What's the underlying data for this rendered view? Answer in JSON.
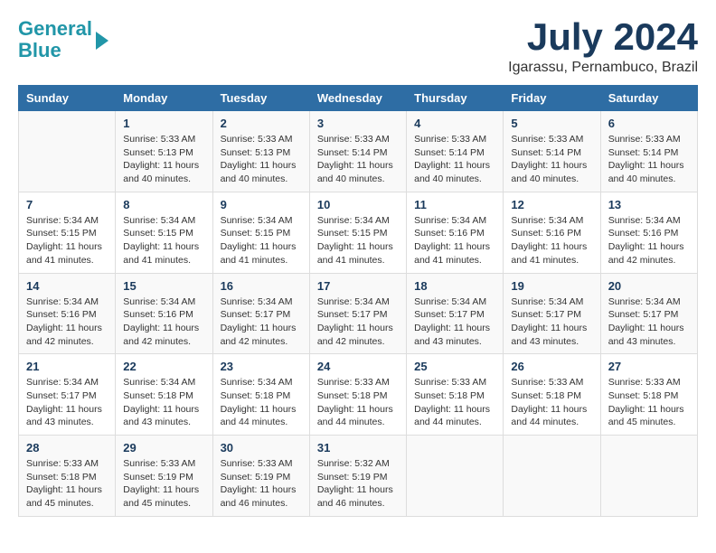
{
  "header": {
    "logo_line1": "General",
    "logo_line2": "Blue",
    "month_title": "July 2024",
    "location": "Igarassu, Pernambuco, Brazil"
  },
  "columns": [
    "Sunday",
    "Monday",
    "Tuesday",
    "Wednesday",
    "Thursday",
    "Friday",
    "Saturday"
  ],
  "weeks": [
    [
      {
        "day": "",
        "info": ""
      },
      {
        "day": "1",
        "info": "Sunrise: 5:33 AM\nSunset: 5:13 PM\nDaylight: 11 hours\nand 40 minutes."
      },
      {
        "day": "2",
        "info": "Sunrise: 5:33 AM\nSunset: 5:13 PM\nDaylight: 11 hours\nand 40 minutes."
      },
      {
        "day": "3",
        "info": "Sunrise: 5:33 AM\nSunset: 5:14 PM\nDaylight: 11 hours\nand 40 minutes."
      },
      {
        "day": "4",
        "info": "Sunrise: 5:33 AM\nSunset: 5:14 PM\nDaylight: 11 hours\nand 40 minutes."
      },
      {
        "day": "5",
        "info": "Sunrise: 5:33 AM\nSunset: 5:14 PM\nDaylight: 11 hours\nand 40 minutes."
      },
      {
        "day": "6",
        "info": "Sunrise: 5:33 AM\nSunset: 5:14 PM\nDaylight: 11 hours\nand 40 minutes."
      }
    ],
    [
      {
        "day": "7",
        "info": "Sunrise: 5:34 AM\nSunset: 5:15 PM\nDaylight: 11 hours\nand 41 minutes."
      },
      {
        "day": "8",
        "info": "Sunrise: 5:34 AM\nSunset: 5:15 PM\nDaylight: 11 hours\nand 41 minutes."
      },
      {
        "day": "9",
        "info": "Sunrise: 5:34 AM\nSunset: 5:15 PM\nDaylight: 11 hours\nand 41 minutes."
      },
      {
        "day": "10",
        "info": "Sunrise: 5:34 AM\nSunset: 5:15 PM\nDaylight: 11 hours\nand 41 minutes."
      },
      {
        "day": "11",
        "info": "Sunrise: 5:34 AM\nSunset: 5:16 PM\nDaylight: 11 hours\nand 41 minutes."
      },
      {
        "day": "12",
        "info": "Sunrise: 5:34 AM\nSunset: 5:16 PM\nDaylight: 11 hours\nand 41 minutes."
      },
      {
        "day": "13",
        "info": "Sunrise: 5:34 AM\nSunset: 5:16 PM\nDaylight: 11 hours\nand 42 minutes."
      }
    ],
    [
      {
        "day": "14",
        "info": "Sunrise: 5:34 AM\nSunset: 5:16 PM\nDaylight: 11 hours\nand 42 minutes."
      },
      {
        "day": "15",
        "info": "Sunrise: 5:34 AM\nSunset: 5:16 PM\nDaylight: 11 hours\nand 42 minutes."
      },
      {
        "day": "16",
        "info": "Sunrise: 5:34 AM\nSunset: 5:17 PM\nDaylight: 11 hours\nand 42 minutes."
      },
      {
        "day": "17",
        "info": "Sunrise: 5:34 AM\nSunset: 5:17 PM\nDaylight: 11 hours\nand 42 minutes."
      },
      {
        "day": "18",
        "info": "Sunrise: 5:34 AM\nSunset: 5:17 PM\nDaylight: 11 hours\nand 43 minutes."
      },
      {
        "day": "19",
        "info": "Sunrise: 5:34 AM\nSunset: 5:17 PM\nDaylight: 11 hours\nand 43 minutes."
      },
      {
        "day": "20",
        "info": "Sunrise: 5:34 AM\nSunset: 5:17 PM\nDaylight: 11 hours\nand 43 minutes."
      }
    ],
    [
      {
        "day": "21",
        "info": "Sunrise: 5:34 AM\nSunset: 5:17 PM\nDaylight: 11 hours\nand 43 minutes."
      },
      {
        "day": "22",
        "info": "Sunrise: 5:34 AM\nSunset: 5:18 PM\nDaylight: 11 hours\nand 43 minutes."
      },
      {
        "day": "23",
        "info": "Sunrise: 5:34 AM\nSunset: 5:18 PM\nDaylight: 11 hours\nand 44 minutes."
      },
      {
        "day": "24",
        "info": "Sunrise: 5:33 AM\nSunset: 5:18 PM\nDaylight: 11 hours\nand 44 minutes."
      },
      {
        "day": "25",
        "info": "Sunrise: 5:33 AM\nSunset: 5:18 PM\nDaylight: 11 hours\nand 44 minutes."
      },
      {
        "day": "26",
        "info": "Sunrise: 5:33 AM\nSunset: 5:18 PM\nDaylight: 11 hours\nand 44 minutes."
      },
      {
        "day": "27",
        "info": "Sunrise: 5:33 AM\nSunset: 5:18 PM\nDaylight: 11 hours\nand 45 minutes."
      }
    ],
    [
      {
        "day": "28",
        "info": "Sunrise: 5:33 AM\nSunset: 5:18 PM\nDaylight: 11 hours\nand 45 minutes."
      },
      {
        "day": "29",
        "info": "Sunrise: 5:33 AM\nSunset: 5:19 PM\nDaylight: 11 hours\nand 45 minutes."
      },
      {
        "day": "30",
        "info": "Sunrise: 5:33 AM\nSunset: 5:19 PM\nDaylight: 11 hours\nand 46 minutes."
      },
      {
        "day": "31",
        "info": "Sunrise: 5:32 AM\nSunset: 5:19 PM\nDaylight: 11 hours\nand 46 minutes."
      },
      {
        "day": "",
        "info": ""
      },
      {
        "day": "",
        "info": ""
      },
      {
        "day": "",
        "info": ""
      }
    ]
  ]
}
